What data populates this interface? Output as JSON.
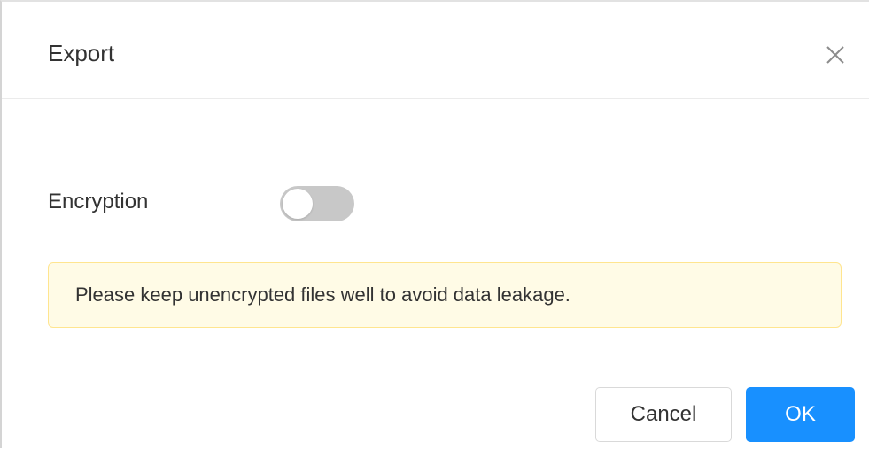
{
  "dialog": {
    "title": "Export",
    "close_icon": "close-icon"
  },
  "encryption": {
    "label": "Encryption",
    "enabled": false,
    "switch_off_color": "#c8c8c8"
  },
  "notice": {
    "text": "Please keep unencrypted files well to avoid data leakage.",
    "background_color": "#fffbe6",
    "border_color": "#ffe58f"
  },
  "footer": {
    "cancel_label": "Cancel",
    "ok_label": "OK",
    "primary_color": "#1890ff"
  }
}
